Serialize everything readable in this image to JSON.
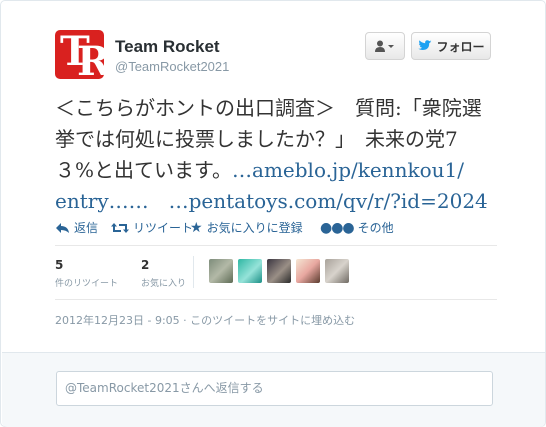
{
  "author": {
    "avatar_letters": "TR",
    "fullname": "Team Rocket",
    "screenname": "@TeamRocket2021"
  },
  "header_buttons": {
    "user_menu_icon": "person-dropdown-icon",
    "follow_label": "フォロー"
  },
  "tweet": {
    "line1": "＜こちらがホントの出口調査＞　質問:「衆院選",
    "line2": "挙では何処に投票しましたか？」　未来の党7",
    "line3_text": "３%と出ています。",
    "link1": "…ameblo.jp/kennkou1/",
    "link2": "entry……",
    "link3": "…pentatoys.com/qv/r/?id=2024"
  },
  "actions": {
    "reply": "返信",
    "retweet": "リツイート",
    "favorite": "お気に入りに登録",
    "more": "その他"
  },
  "stats": {
    "retweets_count": "5",
    "retweets_label": "件のリツイート",
    "favorites_count": "2",
    "favorites_label": "お気に入り"
  },
  "timestamp": "2012年12月23日 - 9:05 · このツイートをサイトに埋め込む",
  "reply": {
    "placeholder": "@TeamRocket2021さんへ返信する"
  },
  "colors": {
    "link": "#2a6496",
    "avatar_bg": "#d9211f",
    "muted": "#8899a6"
  }
}
